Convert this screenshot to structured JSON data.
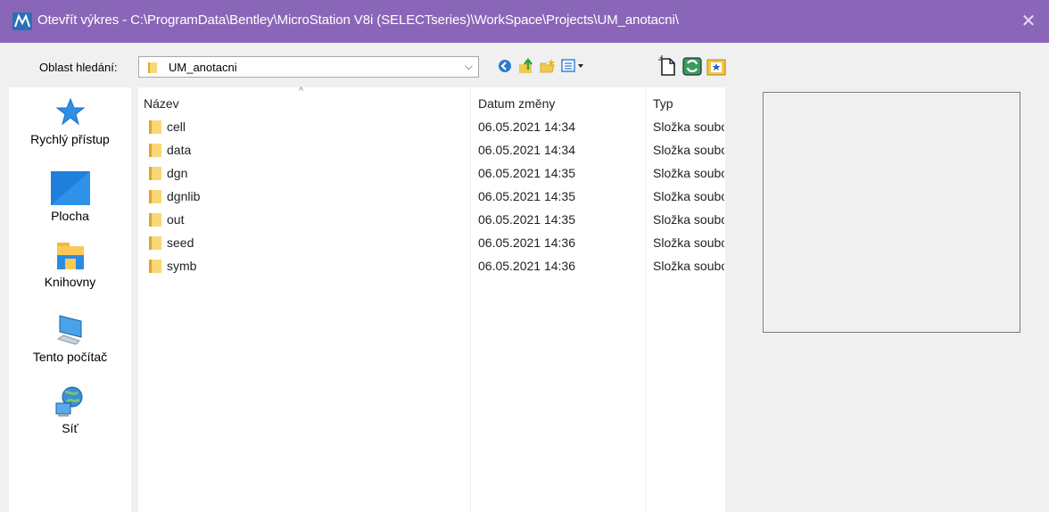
{
  "window": {
    "title": "Otevřít výkres - C:\\ProgramData\\Bentley\\MicroStation V8i (SELECTseries)\\WorkSpace\\Projects\\UM_anotacni\\",
    "close_glyph": "✕",
    "titlebar_color": "#8a66b8"
  },
  "lookin": {
    "label": "Oblast hledání:",
    "value": "UM_anotacni",
    "arrow": "⌵"
  },
  "toolbar": {
    "buttons": [
      "back-icon",
      "up-folder-icon",
      "new-folder-icon",
      "view-menu-icon",
      "new-file-icon",
      "refresh-icon",
      "favorite-icon"
    ]
  },
  "places": [
    {
      "label": "Rychlý přístup",
      "icon": "star-icon"
    },
    {
      "label": "Plocha",
      "icon": "desktop-icon"
    },
    {
      "label": "Knihovny",
      "icon": "libraries-icon"
    },
    {
      "label": "Tento počítač",
      "icon": "computer-icon"
    },
    {
      "label": "Síť",
      "icon": "network-icon"
    }
  ],
  "filelist": {
    "columns": {
      "name": "Název",
      "date": "Datum změny",
      "type": "Typ"
    },
    "sort_indicator": "^",
    "rows": [
      {
        "name": "cell",
        "date": "06.05.2021 14:34",
        "type": "Složka soubor"
      },
      {
        "name": "data",
        "date": "06.05.2021 14:34",
        "type": "Složka soubor"
      },
      {
        "name": "dgn",
        "date": "06.05.2021 14:35",
        "type": "Složka soubor"
      },
      {
        "name": "dgnlib",
        "date": "06.05.2021 14:35",
        "type": "Složka soubor"
      },
      {
        "name": "out",
        "date": "06.05.2021 14:35",
        "type": "Složka soubor"
      },
      {
        "name": "seed",
        "date": "06.05.2021 14:36",
        "type": "Složka soubor"
      },
      {
        "name": "symb",
        "date": "06.05.2021 14:36",
        "type": "Složka soubor"
      }
    ]
  }
}
